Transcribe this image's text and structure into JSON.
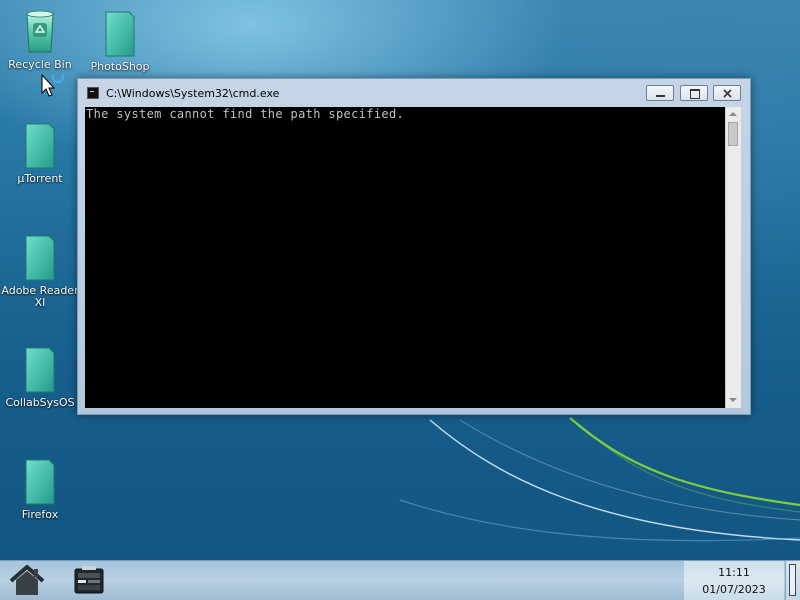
{
  "desktop": {
    "icons": [
      {
        "label": "Recycle Bin",
        "icon": "recycle-bin-icon"
      },
      {
        "label": "PhotoShop",
        "icon": "document-icon"
      },
      {
        "label": "µTorrent",
        "icon": "document-icon"
      },
      {
        "label": "Adobe Reader XI",
        "icon": "document-icon"
      },
      {
        "label": "CollabSysOS",
        "icon": "document-icon"
      },
      {
        "label": "Firefox",
        "icon": "document-icon"
      }
    ]
  },
  "cmd_window": {
    "title": "C:\\Windows\\System32\\cmd.exe",
    "output": "The system cannot find the path specified.",
    "buttons": {
      "minimize": "minimize-icon",
      "maximize": "maximize-icon",
      "close": "close-icon"
    }
  },
  "taskbar": {
    "start_icon": "home-icon",
    "pinned_app_icon": "terminal-icon",
    "clock": {
      "time": "11:11",
      "date": "01/07/2023"
    }
  },
  "colors": {
    "desktop_background": "#1e6b98",
    "console_background": "#000000",
    "console_text": "#c0c0c0",
    "taskbar": "#b8d0e2",
    "icon_teal": "#2fb2a2"
  }
}
